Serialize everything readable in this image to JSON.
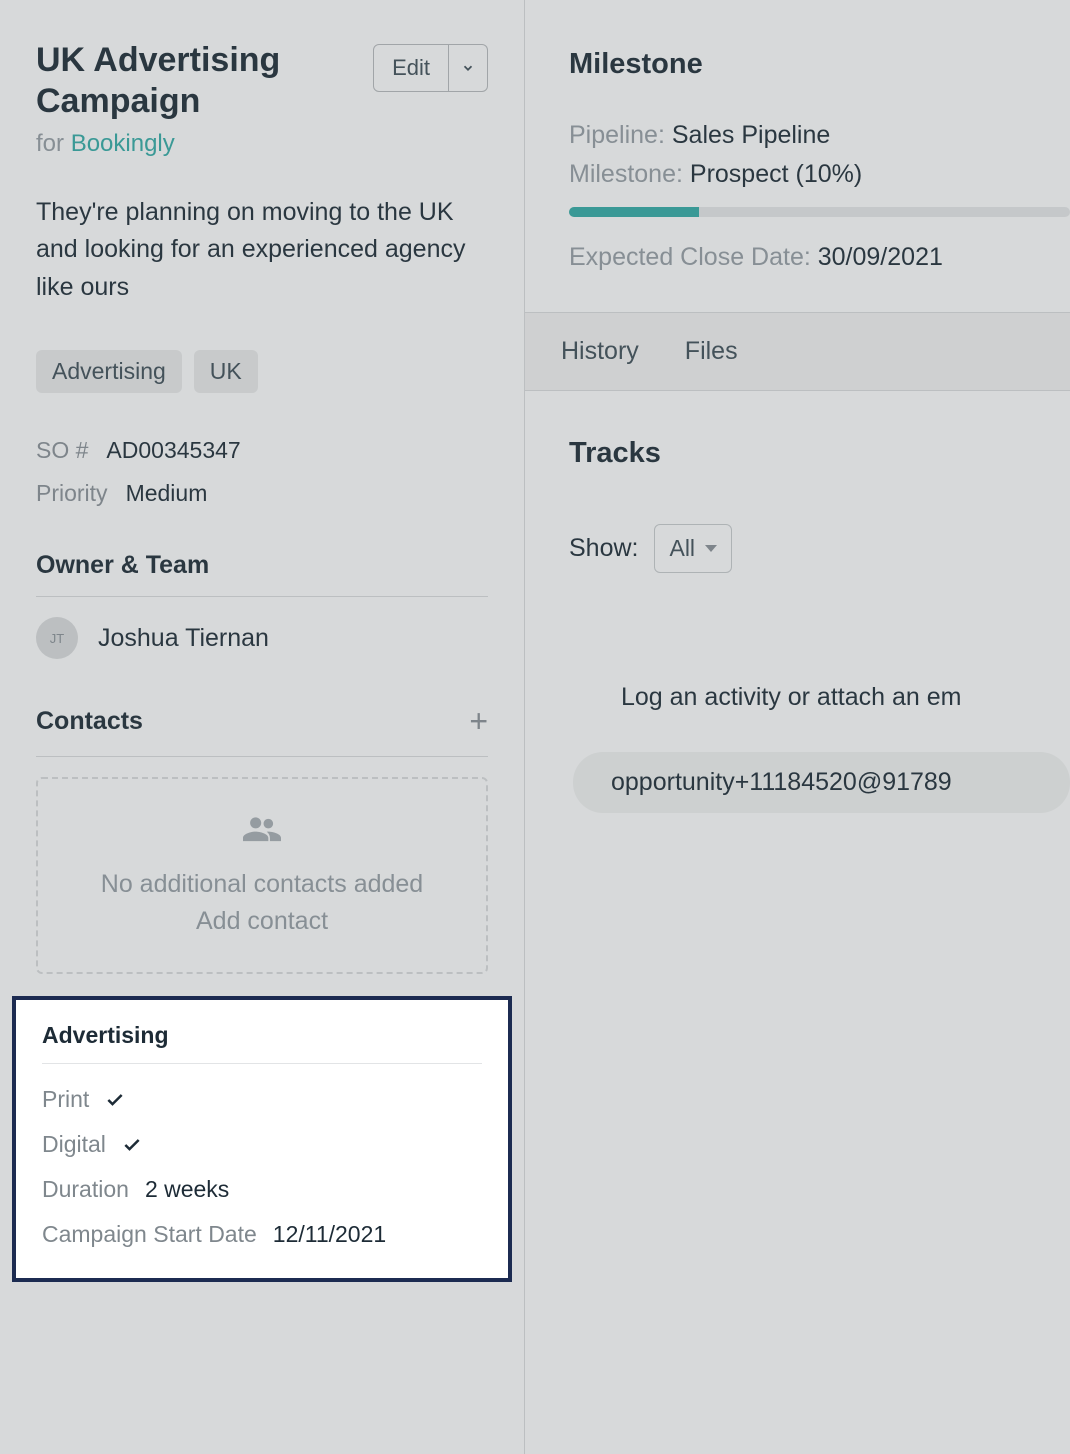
{
  "header": {
    "title": "UK Advertising Campaign",
    "edit_label": "Edit",
    "for_prefix": "for ",
    "for_link": "Bookingly"
  },
  "description": "They're planning on moving to the UK and looking for an experienced agency like ours",
  "tags": [
    "Advertising",
    "UK"
  ],
  "fields": {
    "so_label": "SO #",
    "so_value": "AD00345347",
    "priority_label": "Priority",
    "priority_value": "Medium"
  },
  "owner": {
    "section_title": "Owner & Team",
    "name": "Joshua Tiernan",
    "initials": "JT"
  },
  "contacts": {
    "section_title": "Contacts",
    "empty_text": "No additional contacts added",
    "add_text": "Add contact"
  },
  "advertising": {
    "section_title": "Advertising",
    "print_label": "Print",
    "digital_label": "Digital",
    "duration_label": "Duration",
    "duration_value": "2 weeks",
    "start_label": "Campaign Start Date",
    "start_value": "12/11/2021"
  },
  "milestone": {
    "title": "Milestone",
    "pipeline_label": "Pipeline:",
    "pipeline_value": "Sales Pipeline",
    "milestone_label": "Milestone:",
    "milestone_value": "Prospect (10%)",
    "expected_label": "Expected Close Date:",
    "expected_value": "30/09/2021",
    "progress_percent": 26
  },
  "tabs": {
    "history": "History",
    "files": "Files"
  },
  "tracks": {
    "title": "Tracks",
    "show_label": "Show:",
    "show_value": "All",
    "log_prompt": "Log an activity or attach an em",
    "email": "opportunity+11184520@91789"
  }
}
